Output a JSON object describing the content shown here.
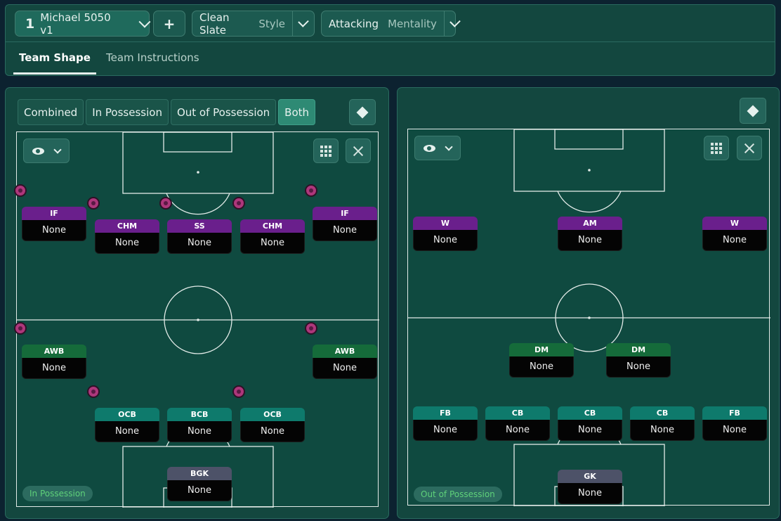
{
  "header": {
    "tactic_number": "1",
    "tactic_name": "Michael 5050 v1",
    "add_label": "+",
    "style_value": "Clean Slate",
    "style_label": "Style",
    "mentality_value": "Attacking",
    "mentality_label": "Mentality",
    "tabs": [
      {
        "label": "Team Shape",
        "active": true
      },
      {
        "label": "Team Instructions",
        "active": false
      }
    ]
  },
  "left_panel": {
    "phase_tabs": [
      {
        "label": "Combined",
        "active": false
      },
      {
        "label": "In Possession",
        "active": false
      },
      {
        "label": "Out of Possession",
        "active": false
      },
      {
        "label": "Both",
        "active": true
      }
    ],
    "phase_badge": "In Possession",
    "players": [
      {
        "role": "IF",
        "name": "None",
        "color": "#6a1f8c",
        "ball": true
      },
      {
        "role": "CHM",
        "name": "None",
        "color": "#6a1f8c",
        "ball": true
      },
      {
        "role": "SS",
        "name": "None",
        "color": "#6a1f8c",
        "ball": true
      },
      {
        "role": "CHM",
        "name": "None",
        "color": "#6a1f8c",
        "ball": true
      },
      {
        "role": "IF",
        "name": "None",
        "color": "#6a1f8c",
        "ball": true
      },
      {
        "role": "AWB",
        "name": "None",
        "color": "#156b3a",
        "ball": true
      },
      {
        "role": "AWB",
        "name": "None",
        "color": "#156b3a",
        "ball": true
      },
      {
        "role": "OCB",
        "name": "None",
        "color": "#0e7a6c",
        "ball": true
      },
      {
        "role": "BCB",
        "name": "None",
        "color": "#0e7a6c",
        "ball": false
      },
      {
        "role": "OCB",
        "name": "None",
        "color": "#0e7a6c",
        "ball": true
      },
      {
        "role": "BGK",
        "name": "None",
        "color": "#4d5268",
        "ball": false,
        "keeper": true
      }
    ]
  },
  "right_panel": {
    "phase_badge": "Out of Possession",
    "players": [
      {
        "role": "W",
        "name": "None",
        "color": "#6a1f8c"
      },
      {
        "role": "AM",
        "name": "None",
        "color": "#6a1f8c"
      },
      {
        "role": "W",
        "name": "None",
        "color": "#6a1f8c"
      },
      {
        "role": "DM",
        "name": "None",
        "color": "#156b3a"
      },
      {
        "role": "DM",
        "name": "None",
        "color": "#156b3a"
      },
      {
        "role": "FB",
        "name": "None",
        "color": "#0e7a6c"
      },
      {
        "role": "CB",
        "name": "None",
        "color": "#0e7a6c"
      },
      {
        "role": "CB",
        "name": "None",
        "color": "#0e7a6c"
      },
      {
        "role": "CB",
        "name": "None",
        "color": "#0e7a6c"
      },
      {
        "role": "FB",
        "name": "None",
        "color": "#0e7a6c"
      },
      {
        "role": "GK",
        "name": "None",
        "color": "#4d5268",
        "keeper": true
      }
    ]
  },
  "icons": {
    "tactic_menu": "chevron-down-icon",
    "add": "plus-icon",
    "panel_options": "diamond-icon",
    "view": "eye-icon",
    "grid": "grid-icon",
    "expand": "expand-icon",
    "ball": "ball-icon",
    "shirt": "shirt-icon"
  },
  "colors": {
    "background": "#0c2230",
    "panel": "#13473f",
    "pitch": "#0f4a40",
    "attack_role": "#6a1f8c",
    "midfield_role": "#156b3a",
    "defense_role": "#0e7a6c",
    "keeper_role": "#4d5268",
    "badge_text": "#5fd17a"
  }
}
